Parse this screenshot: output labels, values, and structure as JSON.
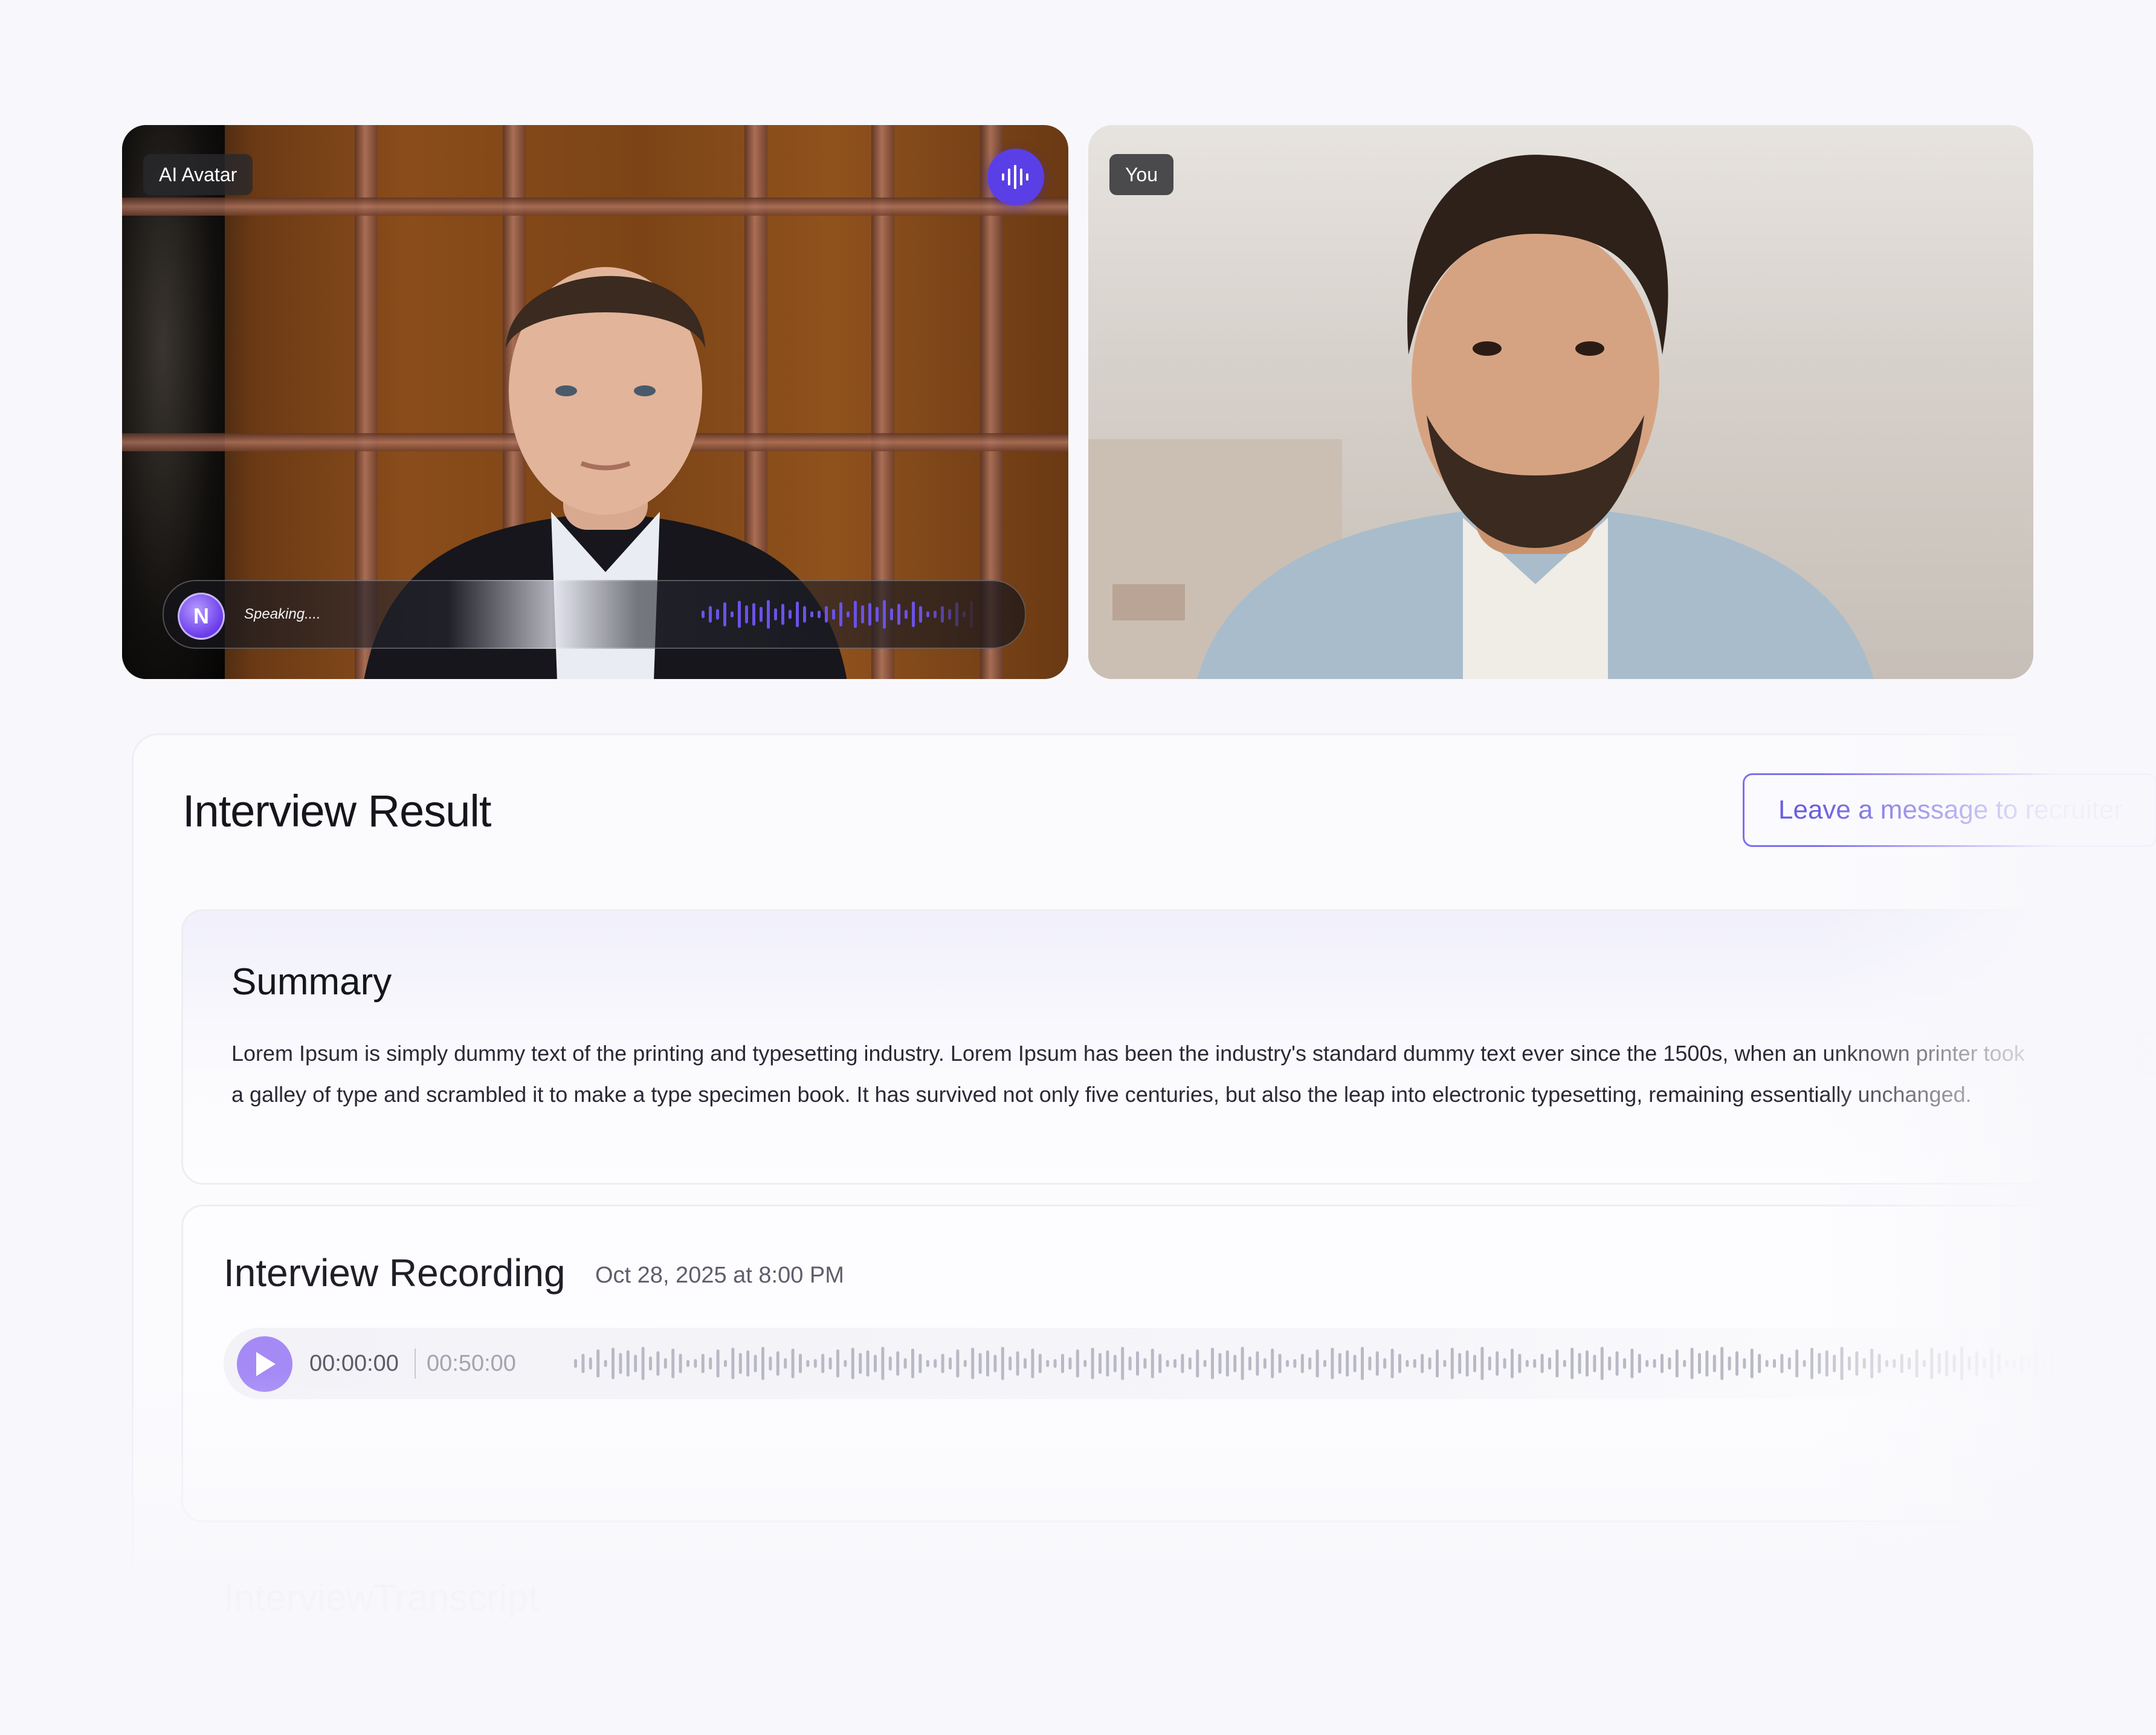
{
  "video": {
    "ai_label": "AI Avatar",
    "you_label": "You",
    "speaking_status": "Speaking....",
    "avatar_logo": "N",
    "speak_icon": "audio-wave-icon"
  },
  "result": {
    "title": "Interview Result",
    "message_button": "Leave a message to recruiter"
  },
  "summary": {
    "title": "Summary",
    "text": "Lorem Ipsum is simply dummy text of the printing and typesetting industry. Lorem Ipsum has been the industry's standard dummy text ever since the 1500s, when an unknown printer took a galley of type and scrambled it to make a type specimen book. It has survived not only five centuries, but also the leap into electronic typesetting, remaining essentially unchanged."
  },
  "recording": {
    "title": "Interview Recording",
    "date": "Oct 28, 2025 at 8:00 PM",
    "current_time": "00:00:00",
    "total_time": "00:50:00",
    "play_icon": "play-icon"
  },
  "transcript": {
    "title": "InterviewTranscript"
  },
  "colors": {
    "accent": "#5b3fe6",
    "play": "#a58af6",
    "button_border": "#7d6ff0"
  }
}
